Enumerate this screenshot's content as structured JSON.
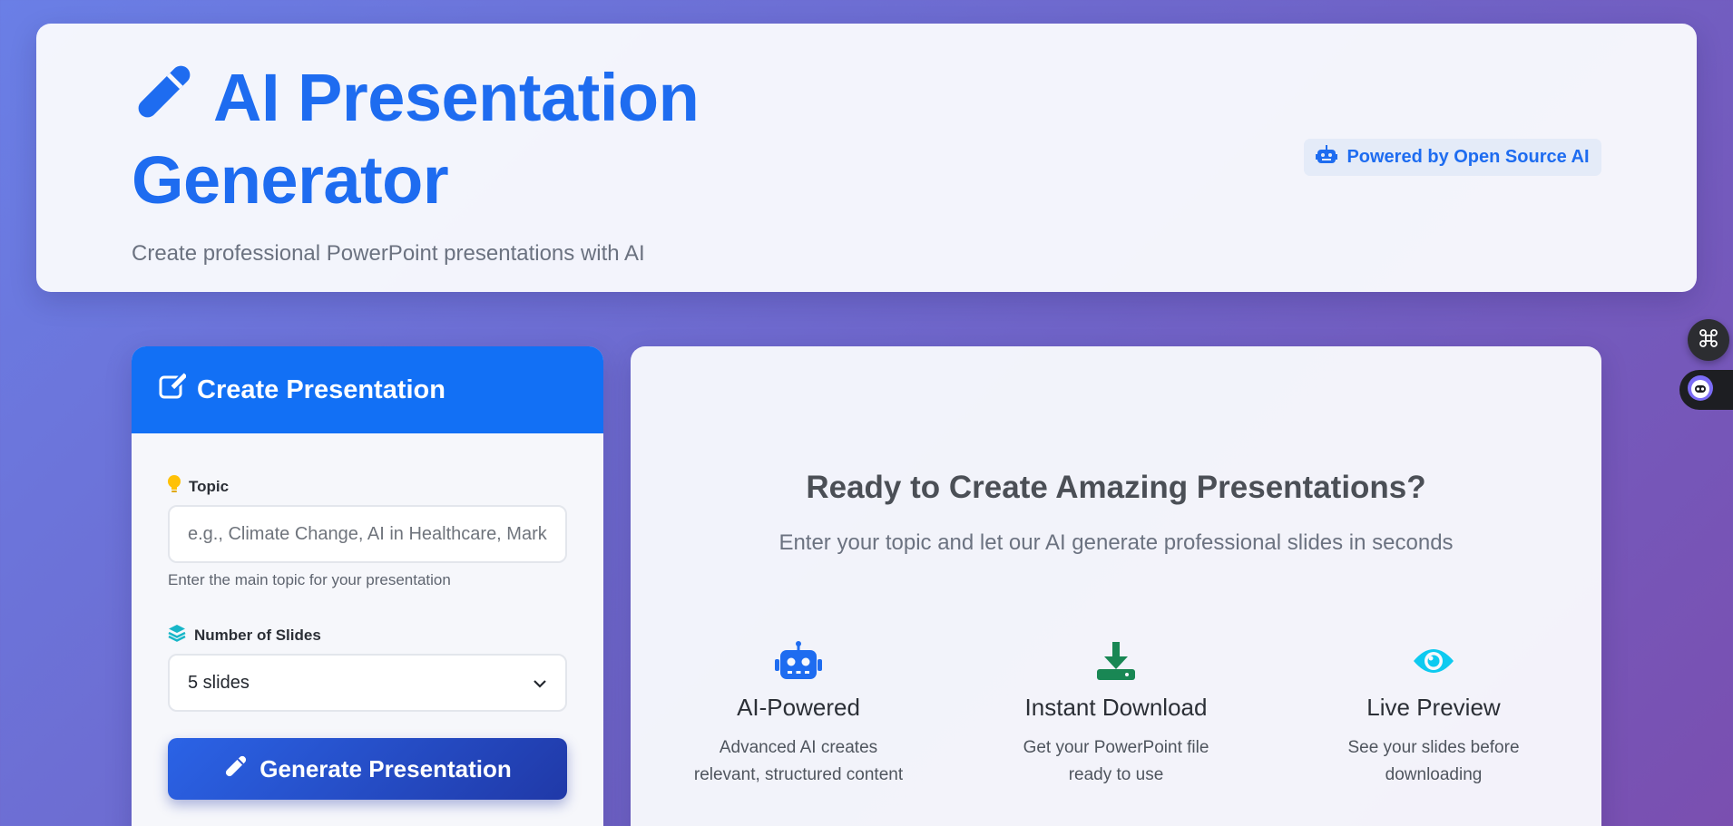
{
  "header": {
    "title": "AI Presentation Generator",
    "subtitle": "Create professional PowerPoint presentations with AI",
    "badge": "Powered by Open Source AI"
  },
  "form": {
    "heading": "Create Presentation",
    "topic": {
      "label": "Topic",
      "placeholder": "e.g., Climate Change, AI in Healthcare, Marketing Strategy",
      "help": "Enter the main topic for your presentation"
    },
    "slides": {
      "label": "Number of Slides",
      "selected": "5 slides"
    },
    "generate_label": "Generate Presentation"
  },
  "welcome": {
    "title": "Ready to Create Amazing Presentations?",
    "subtitle": "Enter your topic and let our AI generate professional slides in seconds",
    "features": [
      {
        "title": "AI-Powered",
        "desc_line1": "Advanced AI creates",
        "desc_line2": "relevant, structured content",
        "icon": "robot-icon"
      },
      {
        "title": "Instant Download",
        "desc_line1": "Get your PowerPoint file",
        "desc_line2": "ready to use",
        "icon": "download-icon"
      },
      {
        "title": "Live Preview",
        "desc_line1": "See your slides before",
        "desc_line2": "downloading",
        "icon": "eye-icon"
      }
    ]
  },
  "colors": {
    "primary": "#1e6cf0",
    "header_blue": "#1270f5",
    "download_green": "#198754",
    "preview_cyan": "#0dcaf0",
    "topic_icon_yellow": "#ffc107"
  }
}
